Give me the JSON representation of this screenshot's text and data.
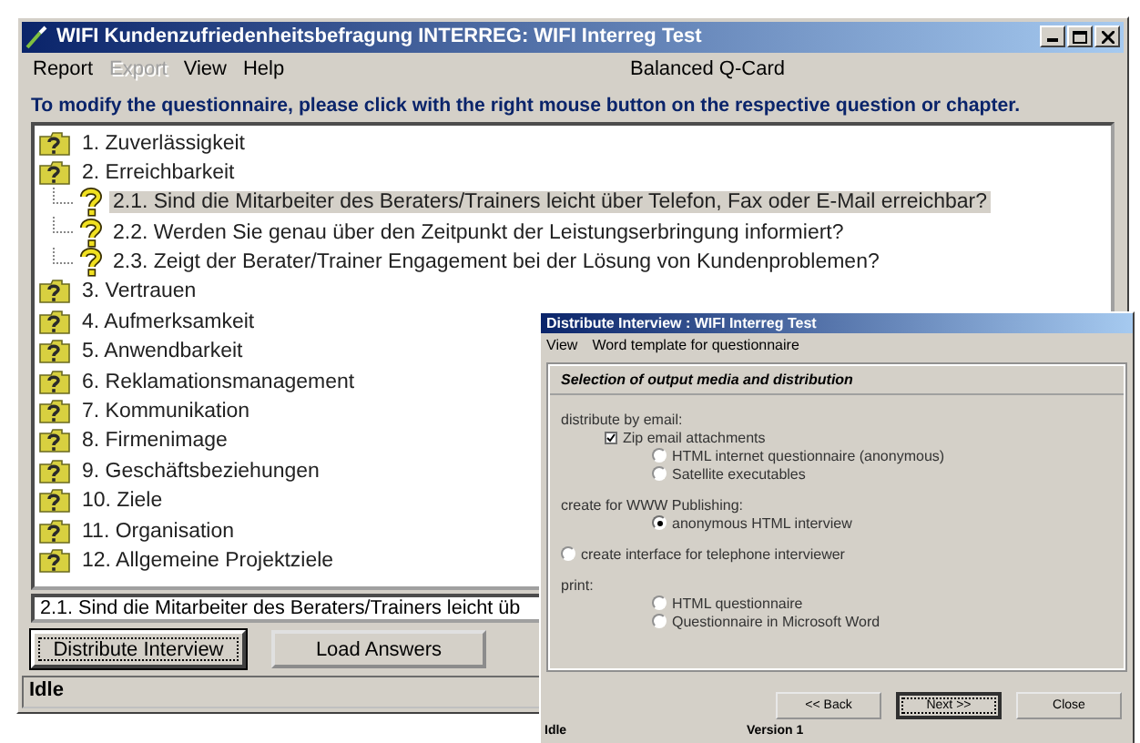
{
  "window": {
    "title": "WIFI Kundenzufriedenheitsbefragung INTERREG: WIFI Interreg Test"
  },
  "menu": [
    {
      "label": "Report",
      "disabled": false
    },
    {
      "label": "Export",
      "disabled": true
    },
    {
      "label": "View",
      "disabled": false
    },
    {
      "label": "Help",
      "disabled": false
    }
  ],
  "menu_caption": "Balanced Q-Card",
  "instruction": "To modify the questionnaire, please click with the right mouse button on the respective question or chapter.",
  "tree": [
    {
      "label": "1. Zuverlässigkeit",
      "selected": false
    },
    {
      "label": "2. Erreichbarkeit",
      "selected": false,
      "children": [
        {
          "label": "2.1. Sind die Mitarbeiter des Beraters/Trainers leicht über Telefon, Fax oder E-Mail erreichbar?",
          "selected": true
        },
        {
          "label": "2.2. Werden Sie genau über den Zeitpunkt der Leistungserbringung informiert?",
          "selected": false
        },
        {
          "label": "2.3. Zeigt der Berater/Trainer Engagement bei der Lösung von Kundenproblemen?",
          "selected": false
        }
      ]
    },
    {
      "label": "3. Vertrauen",
      "selected": false
    },
    {
      "label": "4. Aufmerksamkeit",
      "selected": false
    },
    {
      "label": "5. Anwendbarkeit",
      "selected": false
    },
    {
      "label": "6. Reklamationsmanagement",
      "selected": false
    },
    {
      "label": "7. Kommunikation",
      "selected": false
    },
    {
      "label": "8. Firmenimage",
      "selected": false
    },
    {
      "label": "9. Geschäftsbeziehungen",
      "selected": false
    },
    {
      "label": "10. Ziele",
      "selected": false
    },
    {
      "label": "11. Organisation",
      "selected": false
    },
    {
      "label": "12. Allgemeine Projektziele",
      "selected": false
    }
  ],
  "question_field": {
    "value": "2.1. Sind die Mitarbeiter des Beraters/Trainers leicht üb"
  },
  "buttons": [
    {
      "label": "Distribute Interview",
      "focused": true
    },
    {
      "label": "Load Answers",
      "focused": false
    }
  ],
  "status_bar": "Idle",
  "dialog": {
    "title": "Distribute Interview : WIFI Interreg Test",
    "menu": [
      "View",
      "Word template for questionnaire"
    ],
    "group_title": "Selection of output media and distribution",
    "sections": [
      {
        "kind": "section",
        "label": "distribute by email:",
        "items": [
          {
            "kind": "checkbox",
            "label": "Zip email attachments",
            "checked": true,
            "children": [
              {
                "kind": "radio",
                "label": "HTML internet questionnaire (anonymous)",
                "selected": false
              },
              {
                "kind": "radio",
                "label": "Satellite executables",
                "selected": false
              }
            ]
          }
        ]
      },
      {
        "kind": "section",
        "label": "create for WWW Publishing:",
        "items": [
          {
            "kind": "radio",
            "label": "anonymous HTML interview",
            "selected": true
          }
        ]
      },
      {
        "kind": "radio",
        "label": "create interface for telephone interviewer",
        "selected": false
      },
      {
        "kind": "section",
        "label": "print:",
        "items": [
          {
            "kind": "radio",
            "label": "HTML questionnaire",
            "selected": false
          },
          {
            "kind": "radio",
            "label": "Questionnaire in Microsoft Word",
            "selected": false
          }
        ]
      }
    ],
    "buttons": [
      {
        "label": "<< Back",
        "default": false
      },
      {
        "label": "Next >>",
        "default": true
      },
      {
        "label": "Close",
        "default": false
      }
    ],
    "status": [
      "Idle",
      "Version 1"
    ]
  }
}
